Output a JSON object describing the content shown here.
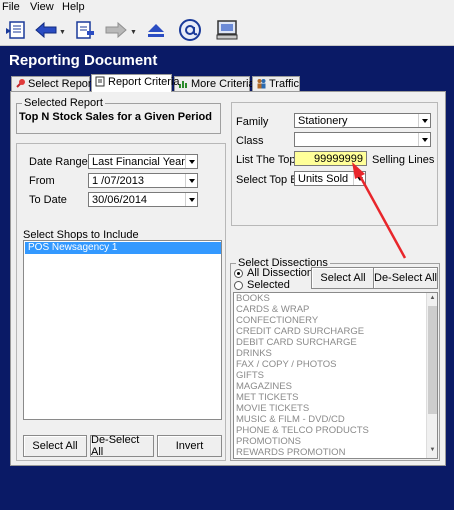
{
  "menu": [
    "File",
    "View",
    "Help"
  ],
  "toolbar": {
    "icons": [
      "report-icon",
      "back-arrow-icon",
      "document-icon",
      "forward-arrow-icon",
      "eject-icon",
      "email-icon",
      "computer-icon"
    ]
  },
  "page": {
    "title": "Reporting Document"
  },
  "tabs": [
    {
      "label": "Select Report"
    },
    {
      "label": "Report Criteria"
    },
    {
      "label": "More Criteria"
    },
    {
      "label": "Traffic"
    }
  ],
  "selected_report": {
    "group_label": "Selected Report",
    "name": "Top N Stock Sales for a Given Period"
  },
  "dates": {
    "date_range_label": "Date Range",
    "date_range_value": "Last Financial Year",
    "from_label": "From",
    "from_value": "1 /07/2013",
    "to_label": "To Date",
    "to_value": "30/06/2014"
  },
  "shops": {
    "label": "Select Shops to Include",
    "items": [
      "POS Newsagency 1"
    ],
    "select_all": "Select All",
    "deselect_all": "De-Select All",
    "invert": "Invert"
  },
  "criteria": {
    "family_label": "Family",
    "family_value": "Stationery",
    "class_label": "Class",
    "class_value": "",
    "list_top_label": "List The Top",
    "list_top_value": "99999999",
    "selling_lines": "Selling Lines",
    "select_top_by_label": "Select Top By",
    "select_top_by_value": "Units Sold"
  },
  "dissections": {
    "group_label": "Select Dissections",
    "all_label": "All Dissections",
    "selected_label": "Selected",
    "select_all": "Select All",
    "deselect_all": "De-Select All",
    "items": [
      "BOOKS",
      "CARDS & WRAP",
      "CONFECTIONERY",
      "CREDIT CARD SURCHARGE",
      "DEBIT CARD SURCHARGE",
      "DRINKS",
      "FAX / COPY / PHOTOS",
      "GIFTS",
      "MAGAZINES",
      "MET TICKETS",
      "MOVIE TICKETS",
      "MUSIC & FILM - DVD/CD",
      "PHONE & TELCO PRODUCTS",
      "PROMOTIONS",
      "REWARDS PROMOTION"
    ]
  },
  "colors": {
    "header_bg": "#0a1a66",
    "highlight_field": "#ffff99",
    "selection": "#3399ff",
    "annotation_arrow": "#e8262b"
  }
}
